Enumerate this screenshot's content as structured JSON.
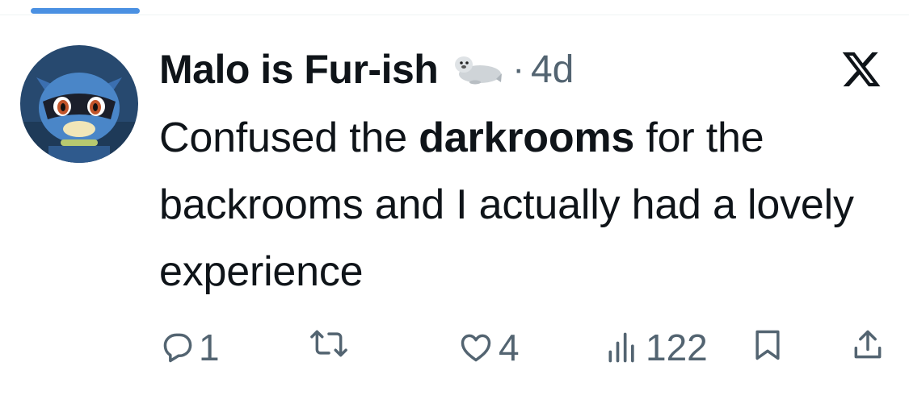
{
  "tweet": {
    "author": "Malo is Fur-ish",
    "separator": "·",
    "time": "4d",
    "text_1": "Confused the ",
    "text_bold": "darkrooms",
    "text_2": " for the backrooms and I actually had a lovely experience",
    "replies": "1",
    "likes": "4",
    "views": "122"
  },
  "icons": {
    "author_emoji": "seal-emoji",
    "brand": "x-logo",
    "reply": "reply-icon",
    "retweet": "retweet-icon",
    "like": "heart-icon",
    "views": "views-icon",
    "bookmark": "bookmark-icon",
    "share": "share-icon"
  },
  "colors": {
    "text": "#0f1419",
    "muted": "#536471",
    "accent": "#4a90e2"
  }
}
